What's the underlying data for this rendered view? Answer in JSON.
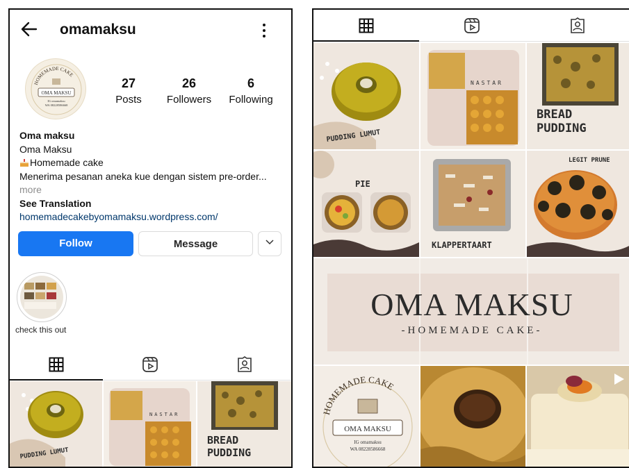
{
  "profile": {
    "username": "omamaksu",
    "avatar": {
      "ring_text": "HOMEMADE CAKE",
      "badge": "OMA MAKSU",
      "line1": "IG omamaksu",
      "line2": "WA 08228586668"
    },
    "stats": [
      {
        "count": "27",
        "label": "Posts"
      },
      {
        "count": "26",
        "label": "Followers"
      },
      {
        "count": "6",
        "label": "Following"
      }
    ],
    "bio": {
      "name": "Oma maksu",
      "line1": "Oma Maksu",
      "line2": "Homemade cake",
      "line3": "Menerima pesanan aneka kue dengan sistem pre-order...",
      "more": "more",
      "see_translation": "See Translation",
      "link": "homemadecakebyomamaksu.wordpress.com/"
    },
    "buttons": {
      "follow": "Follow",
      "message": "Message"
    },
    "highlight": {
      "label": "check this out"
    }
  },
  "icons": [
    "back-arrow-icon",
    "more-options-icon",
    "grid-icon",
    "reels-icon",
    "tagged-icon",
    "chevron-down-icon",
    "cake-emoji-icon",
    "video-play-icon"
  ],
  "posts": {
    "pudding": "PUDDING LUMUT",
    "nastar": "NASTAR",
    "bread1": "BREAD",
    "bread2": "PUDDING",
    "pie": "PIE",
    "klappertaart": "KLAPPERTAART",
    "legit": "LEGIT PRUNE",
    "brand_title": "OMA MAKSU",
    "brand_sub": "-HOMEMADE CAKE-",
    "logo_ring": "HOMEMADE CAKE",
    "logo_badge": "OMA MAKSU",
    "logo_line1": "IG omamaksu",
    "logo_line2": "WA 08228586668"
  },
  "colors": {
    "follow": "#1877f2",
    "link": "#00376b",
    "post_bg": "#efe7df",
    "pudding_green": "#b5a21d"
  }
}
